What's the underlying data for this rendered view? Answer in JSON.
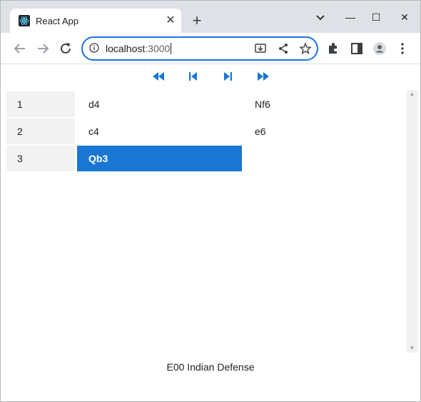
{
  "browser": {
    "tab_title": "React App",
    "tab_close": "✕",
    "new_tab": "+",
    "url_host": "localhost",
    "url_port": ":3000",
    "window_controls": {
      "minimize": "—",
      "maximize": "☐",
      "close": "✕"
    },
    "icons": [
      "react-icon",
      "back-icon",
      "forward-icon",
      "reload-icon",
      "info-icon",
      "install-icon",
      "share-icon",
      "bookmark-star-icon",
      "extensions-icon",
      "side-panel-icon",
      "profile-icon",
      "menu-icon",
      "tab-search-icon"
    ]
  },
  "colors": {
    "accent": "#1976d2",
    "omnibox_border": "#1a73e8",
    "row_header_bg": "#f2f2f2"
  },
  "controls": [
    "first-move",
    "previous-move",
    "next-move",
    "last-move"
  ],
  "moves": [
    {
      "number": "1",
      "white": "d4",
      "black": "Nf6"
    },
    {
      "number": "2",
      "white": "c4",
      "black": "e6"
    },
    {
      "number": "3",
      "white": "Qb3",
      "black": ""
    }
  ],
  "active_move": {
    "row": 3,
    "side": "white"
  },
  "opening": "E00 Indian Defense"
}
